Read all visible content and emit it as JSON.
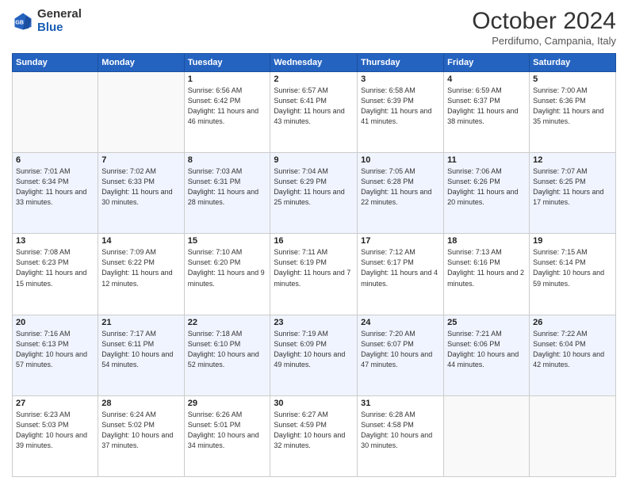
{
  "header": {
    "logo_general": "General",
    "logo_blue": "Blue",
    "month_title": "October 2024",
    "subtitle": "Perdifumo, Campania, Italy"
  },
  "days_of_week": [
    "Sunday",
    "Monday",
    "Tuesday",
    "Wednesday",
    "Thursday",
    "Friday",
    "Saturday"
  ],
  "weeks": [
    [
      {
        "day": "",
        "info": ""
      },
      {
        "day": "",
        "info": ""
      },
      {
        "day": "1",
        "info": "Sunrise: 6:56 AM\nSunset: 6:42 PM\nDaylight: 11 hours and 46 minutes."
      },
      {
        "day": "2",
        "info": "Sunrise: 6:57 AM\nSunset: 6:41 PM\nDaylight: 11 hours and 43 minutes."
      },
      {
        "day": "3",
        "info": "Sunrise: 6:58 AM\nSunset: 6:39 PM\nDaylight: 11 hours and 41 minutes."
      },
      {
        "day": "4",
        "info": "Sunrise: 6:59 AM\nSunset: 6:37 PM\nDaylight: 11 hours and 38 minutes."
      },
      {
        "day": "5",
        "info": "Sunrise: 7:00 AM\nSunset: 6:36 PM\nDaylight: 11 hours and 35 minutes."
      }
    ],
    [
      {
        "day": "6",
        "info": "Sunrise: 7:01 AM\nSunset: 6:34 PM\nDaylight: 11 hours and 33 minutes."
      },
      {
        "day": "7",
        "info": "Sunrise: 7:02 AM\nSunset: 6:33 PM\nDaylight: 11 hours and 30 minutes."
      },
      {
        "day": "8",
        "info": "Sunrise: 7:03 AM\nSunset: 6:31 PM\nDaylight: 11 hours and 28 minutes."
      },
      {
        "day": "9",
        "info": "Sunrise: 7:04 AM\nSunset: 6:29 PM\nDaylight: 11 hours and 25 minutes."
      },
      {
        "day": "10",
        "info": "Sunrise: 7:05 AM\nSunset: 6:28 PM\nDaylight: 11 hours and 22 minutes."
      },
      {
        "day": "11",
        "info": "Sunrise: 7:06 AM\nSunset: 6:26 PM\nDaylight: 11 hours and 20 minutes."
      },
      {
        "day": "12",
        "info": "Sunrise: 7:07 AM\nSunset: 6:25 PM\nDaylight: 11 hours and 17 minutes."
      }
    ],
    [
      {
        "day": "13",
        "info": "Sunrise: 7:08 AM\nSunset: 6:23 PM\nDaylight: 11 hours and 15 minutes."
      },
      {
        "day": "14",
        "info": "Sunrise: 7:09 AM\nSunset: 6:22 PM\nDaylight: 11 hours and 12 minutes."
      },
      {
        "day": "15",
        "info": "Sunrise: 7:10 AM\nSunset: 6:20 PM\nDaylight: 11 hours and 9 minutes."
      },
      {
        "day": "16",
        "info": "Sunrise: 7:11 AM\nSunset: 6:19 PM\nDaylight: 11 hours and 7 minutes."
      },
      {
        "day": "17",
        "info": "Sunrise: 7:12 AM\nSunset: 6:17 PM\nDaylight: 11 hours and 4 minutes."
      },
      {
        "day": "18",
        "info": "Sunrise: 7:13 AM\nSunset: 6:16 PM\nDaylight: 11 hours and 2 minutes."
      },
      {
        "day": "19",
        "info": "Sunrise: 7:15 AM\nSunset: 6:14 PM\nDaylight: 10 hours and 59 minutes."
      }
    ],
    [
      {
        "day": "20",
        "info": "Sunrise: 7:16 AM\nSunset: 6:13 PM\nDaylight: 10 hours and 57 minutes."
      },
      {
        "day": "21",
        "info": "Sunrise: 7:17 AM\nSunset: 6:11 PM\nDaylight: 10 hours and 54 minutes."
      },
      {
        "day": "22",
        "info": "Sunrise: 7:18 AM\nSunset: 6:10 PM\nDaylight: 10 hours and 52 minutes."
      },
      {
        "day": "23",
        "info": "Sunrise: 7:19 AM\nSunset: 6:09 PM\nDaylight: 10 hours and 49 minutes."
      },
      {
        "day": "24",
        "info": "Sunrise: 7:20 AM\nSunset: 6:07 PM\nDaylight: 10 hours and 47 minutes."
      },
      {
        "day": "25",
        "info": "Sunrise: 7:21 AM\nSunset: 6:06 PM\nDaylight: 10 hours and 44 minutes."
      },
      {
        "day": "26",
        "info": "Sunrise: 7:22 AM\nSunset: 6:04 PM\nDaylight: 10 hours and 42 minutes."
      }
    ],
    [
      {
        "day": "27",
        "info": "Sunrise: 6:23 AM\nSunset: 5:03 PM\nDaylight: 10 hours and 39 minutes."
      },
      {
        "day": "28",
        "info": "Sunrise: 6:24 AM\nSunset: 5:02 PM\nDaylight: 10 hours and 37 minutes."
      },
      {
        "day": "29",
        "info": "Sunrise: 6:26 AM\nSunset: 5:01 PM\nDaylight: 10 hours and 34 minutes."
      },
      {
        "day": "30",
        "info": "Sunrise: 6:27 AM\nSunset: 4:59 PM\nDaylight: 10 hours and 32 minutes."
      },
      {
        "day": "31",
        "info": "Sunrise: 6:28 AM\nSunset: 4:58 PM\nDaylight: 10 hours and 30 minutes."
      },
      {
        "day": "",
        "info": ""
      },
      {
        "day": "",
        "info": ""
      }
    ]
  ]
}
